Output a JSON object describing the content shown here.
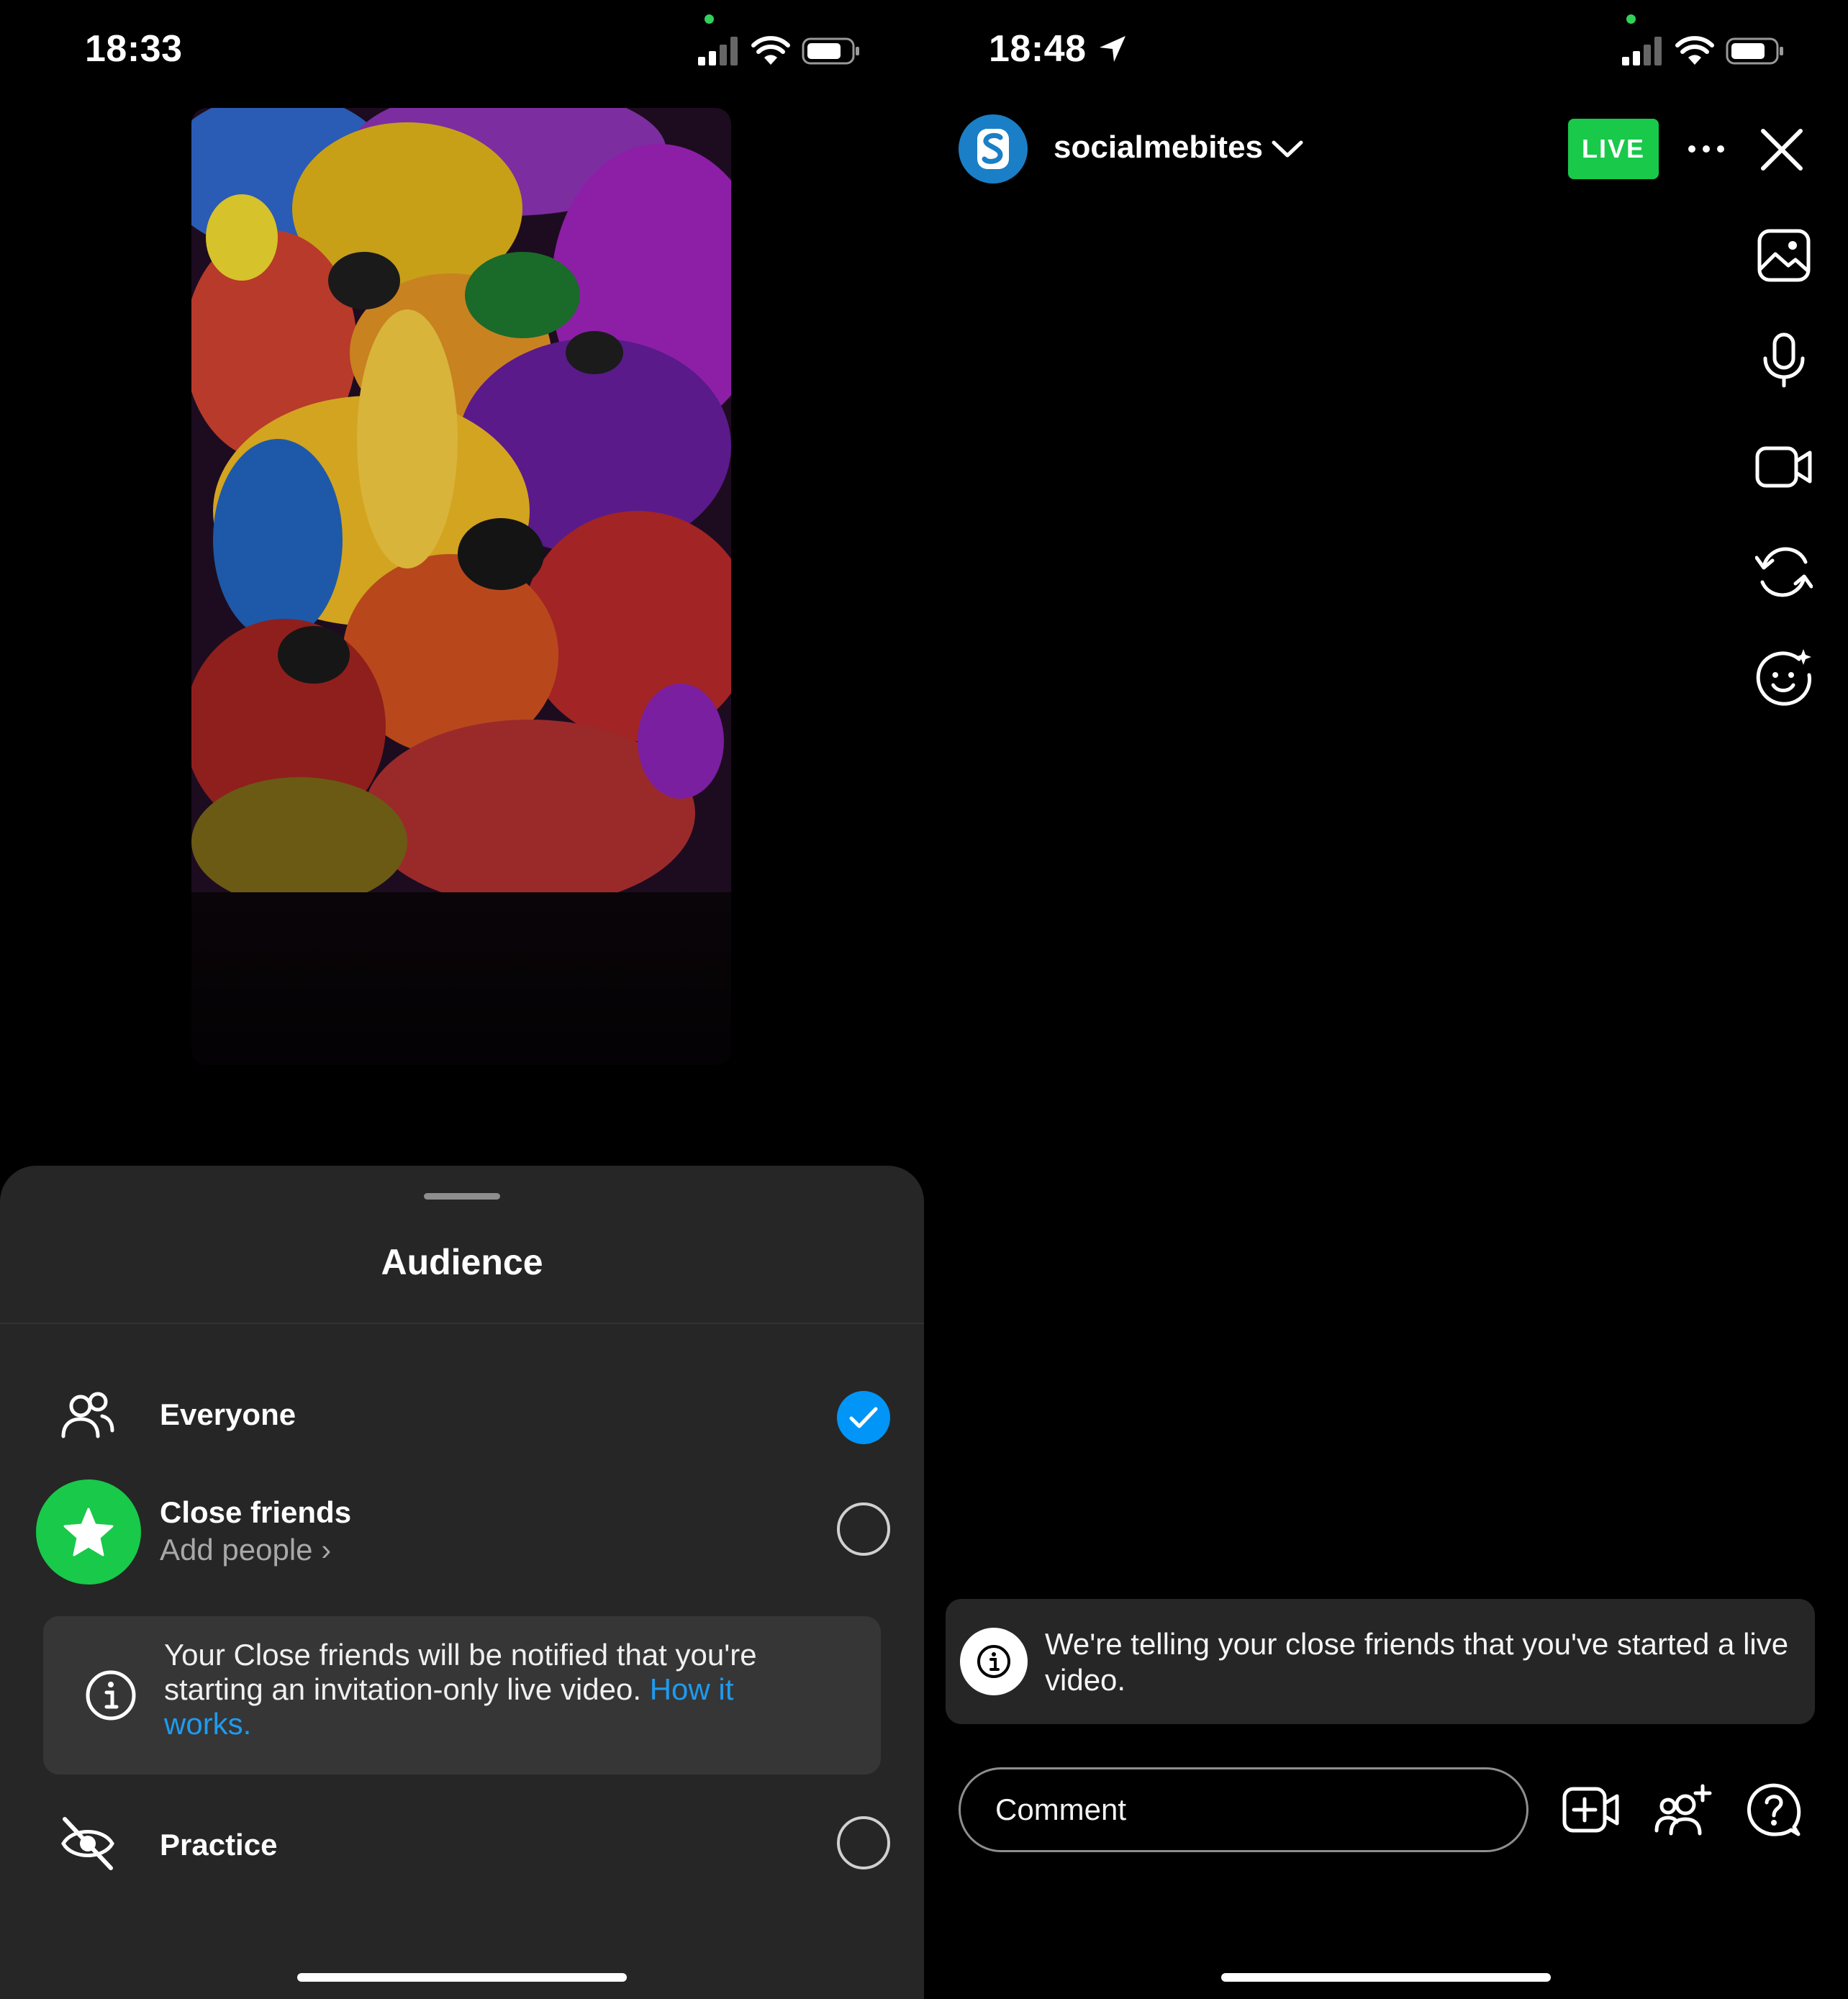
{
  "left": {
    "status": {
      "time": "18:33"
    },
    "sheet": {
      "title": "Audience",
      "options": [
        {
          "label": "Everyone",
          "selected": true,
          "icon": "people-icon"
        },
        {
          "label": "Close friends",
          "sublabel": "Add people ›",
          "selected": false,
          "icon": "star-icon"
        },
        {
          "label": "Practice",
          "selected": false,
          "icon": "eye-off-icon"
        }
      ],
      "notice": {
        "text": "Your Close friends will be notified that you're starting an invitation-only live video. ",
        "link": "How it works."
      }
    }
  },
  "right": {
    "status": {
      "time": "18:48"
    },
    "header": {
      "username": "socialmebites",
      "live_badge": "LIVE"
    },
    "side_tools": [
      "gallery-icon",
      "microphone-icon",
      "video-camera-icon",
      "flip-camera-icon",
      "effects-icon"
    ],
    "toast": {
      "text": "We're telling your close friends that you've started a live video."
    },
    "comment": {
      "placeholder": "Comment"
    },
    "bottom_tools": [
      "add-guest-video-icon",
      "invite-people-icon",
      "question-icon"
    ]
  },
  "colors": {
    "accent_blue": "#0095f6",
    "link_blue": "#1e9bf0",
    "live_green": "#19c94a",
    "sheet_bg": "#262626",
    "notice_bg": "#363636"
  }
}
